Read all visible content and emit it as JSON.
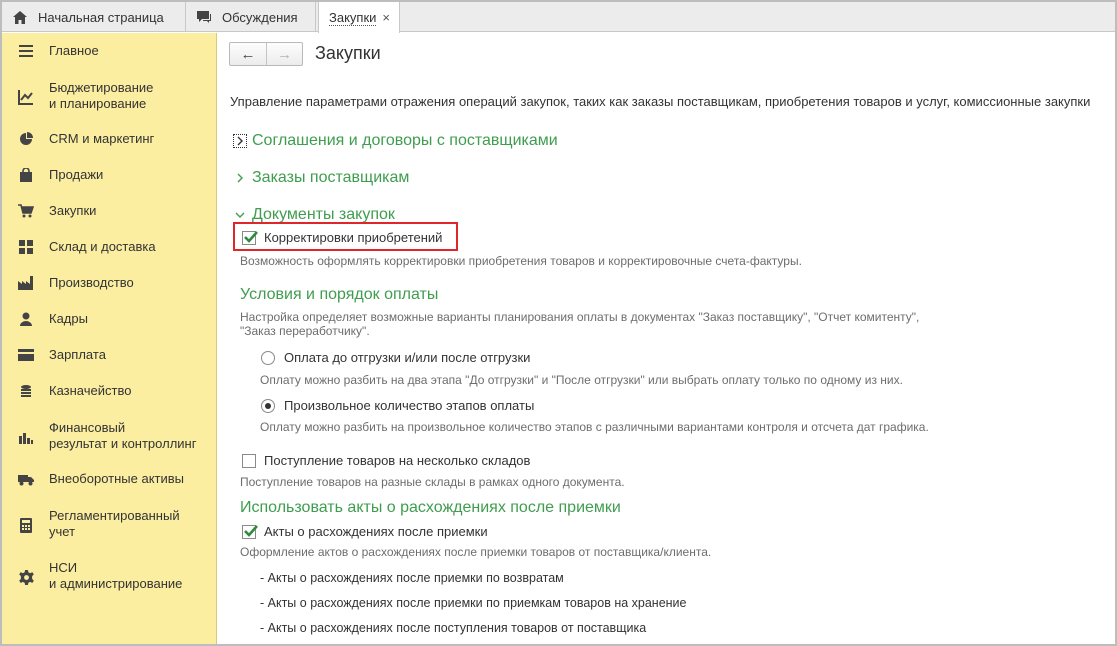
{
  "tabs": {
    "home": "Начальная страница",
    "discussions": "Обсуждения",
    "active": "Закупки",
    "close": "×"
  },
  "sidebar": {
    "items": [
      {
        "label": "Главное",
        "icon": "menu-icon"
      },
      {
        "label": "Бюджетирование\nи планирование",
        "icon": "chart-line-icon"
      },
      {
        "label": "CRM и маркетинг",
        "icon": "pie-chart-icon"
      },
      {
        "label": "Продажи",
        "icon": "shopping-bag-icon"
      },
      {
        "label": "Закупки",
        "icon": "cart-icon"
      },
      {
        "label": "Склад и доставка",
        "icon": "warehouse-grid-icon"
      },
      {
        "label": "Производство",
        "icon": "factory-icon"
      },
      {
        "label": "Кадры",
        "icon": "person-icon"
      },
      {
        "label": "Зарплата",
        "icon": "wallet-icon"
      },
      {
        "label": "Казначейство",
        "icon": "coins-icon"
      },
      {
        "label": "Финансовый\nрезультат и контроллинг",
        "icon": "bar-chart-icon"
      },
      {
        "label": "Внеоборотные активы",
        "icon": "truck-icon"
      },
      {
        "label": "Регламентированный\nучет",
        "icon": "calculator-icon"
      },
      {
        "label": "НСИ\nи администрирование",
        "icon": "gear-icon"
      }
    ]
  },
  "nav": {
    "back": "←",
    "forward": "→"
  },
  "page": {
    "title": "Закупки",
    "description": "Управление параметрами отражения операций закупок, таких как заказы поставщикам, приобретения товаров и услуг, комиссионные закупки"
  },
  "sections": {
    "agreements": "Соглашения и договоры с поставщиками",
    "orders": "Заказы поставщикам",
    "documents": "Документы закупок"
  },
  "corrections": {
    "label": "Корректировки приобретений",
    "checked": true,
    "hint": "Возможность оформлять корректировки приобретения товаров и корректировочные счета-фактуры."
  },
  "payment": {
    "heading": "Условия и порядок оплаты",
    "hint_line1": "Настройка определяет возможные варианты планирования оплаты в документах \"Заказ поставщику\", \"Отчет комитенту\",",
    "hint_line2": "\"Заказ переработчику\".",
    "option1_label": "Оплата до отгрузки и/или после отгрузки",
    "option1_hint": "Оплату можно разбить на два этапа \"До отгрузки\" и \"После отгрузки\" или выбрать оплату только по одному из них.",
    "option2_label": "Произвольное количество этапов оплаты",
    "option2_hint": "Оплату можно разбить на произвольное количество этапов с различными вариантами контроля и отсчета дат графика.",
    "selected": 2
  },
  "multi_warehouse": {
    "label": "Поступление товаров на несколько складов",
    "checked": false,
    "hint": "Поступление товаров на разные склады в рамках одного документа."
  },
  "discrepancy": {
    "heading": "Использовать акты о расхождениях после приемки",
    "label": "Акты о расхождениях после приемки",
    "checked": true,
    "hint": "Оформление актов о расхождениях после приемки товаров от поставщика/клиента.",
    "items": [
      "- Акты о расхождениях после приемки по возвратам",
      "- Акты о расхождениях после приемки по приемкам товаров на хранение",
      "- Акты о расхождениях после поступления товаров от поставщика"
    ]
  },
  "colors": {
    "sidebar_bg": "#fbeea1",
    "section_green": "#3f9d4f",
    "highlight_red": "#e0262b",
    "check_green": "#2e8b3e"
  }
}
